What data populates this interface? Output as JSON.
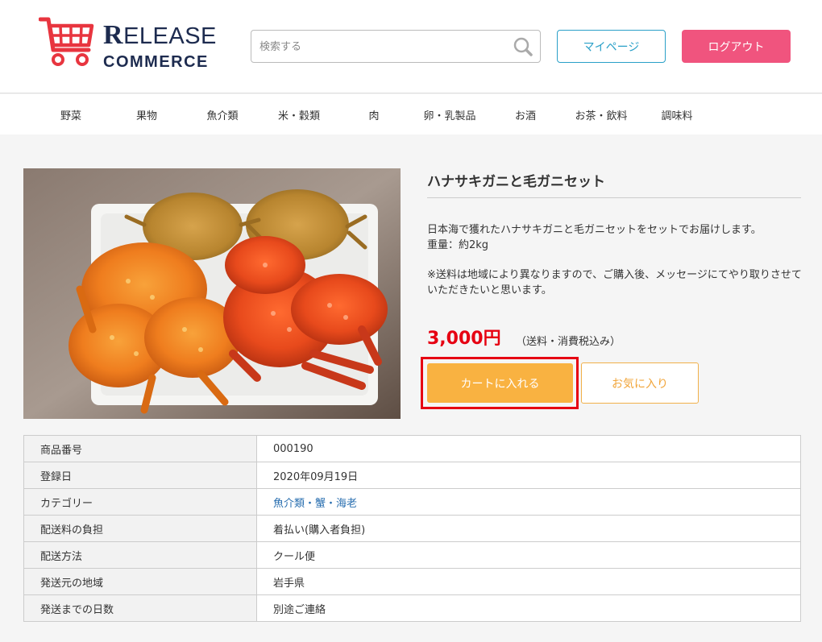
{
  "header": {
    "logo_main_initial": "R",
    "logo_main_rest": "ELEASE",
    "logo_sub": "COMMERCE",
    "search_placeholder": "検索する",
    "mypage_label": "マイページ",
    "logout_label": "ログアウト"
  },
  "nav": {
    "items": [
      "野菜",
      "果物",
      "魚介類",
      "米・穀類",
      "肉",
      "卵・乳製品",
      "お酒",
      "お茶・飲料",
      "調味料"
    ]
  },
  "product": {
    "title": "ハナサキガニと毛ガニセット",
    "description_line1": "日本海で獲れたハナサキガニと毛ガニセットをセットでお届けします。",
    "description_line2": "重量：約2kg",
    "description_line3": "※送料は地域により異なりますので、ご購入後、メッセージにてやり取りさせていただきたいと思います。",
    "price": "3,000円",
    "price_note": "（送料・消費税込み）",
    "cart_button": "カートに入れる",
    "favorite_button": "お気に入り"
  },
  "spec": {
    "rows": [
      {
        "label": "商品番号",
        "value": "000190"
      },
      {
        "label": "登録日",
        "value": "2020年09月19日"
      },
      {
        "label": "カテゴリー",
        "value": "魚介類・蟹・海老"
      },
      {
        "label": "配送料の負担",
        "value": "着払い(購入者負担)"
      },
      {
        "label": "配送方法",
        "value": "クール便"
      },
      {
        "label": "発送元の地域",
        "value": "岩手県"
      },
      {
        "label": "発送までの日数",
        "value": "別途ご連絡"
      }
    ]
  },
  "colors": {
    "accent_pink": "#f0547e",
    "accent_blue": "#2aa0c8",
    "price_red": "#e60012",
    "cart_orange": "#f9b241"
  }
}
